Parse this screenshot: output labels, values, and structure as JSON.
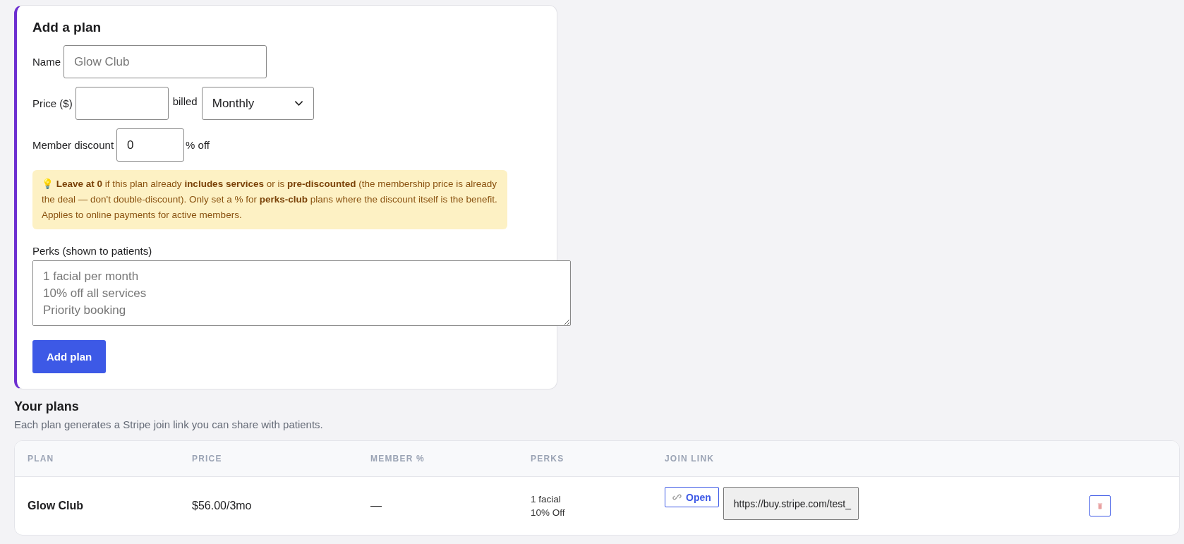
{
  "add_plan": {
    "title": "Add a plan",
    "name_field": {
      "label": "Name",
      "placeholder": "Glow Club"
    },
    "price_field": {
      "label": "Price ($)"
    },
    "billed_label": "billed",
    "billing_select": {
      "value": "Monthly"
    },
    "discount_field": {
      "label": "Member discount",
      "value": "0",
      "suffix": "% off"
    },
    "note": "💡 **Leave at 0** if this plan already **includes services** or is **pre-discounted** (the membership price is already the deal — don't double-discount). Only set a % for **perks-club** plans where the discount itself is the benefit. Applies to online payments for active members.",
    "perks_field": {
      "label": "Perks (shown to patients)",
      "placeholder": "1 facial per month\n10% off all services\nPriority booking"
    },
    "submit_button": "Add plan"
  },
  "plans": {
    "title": "Your plans",
    "subtitle": "Each plan generates a Stripe join link you can share with patients.",
    "table": {
      "columns": [
        "PLAN",
        "PRICE",
        "MEMBER %",
        "PERKS",
        "JOIN LINK"
      ],
      "rows": [
        {
          "plan": "Glow Club",
          "price": "$56.00/3mo",
          "member": "—",
          "perks": [
            "1 facial",
            "10% Off"
          ],
          "open_button": "Open",
          "join_link": "https://buy.stripe.com/test_"
        }
      ]
    }
  }
}
